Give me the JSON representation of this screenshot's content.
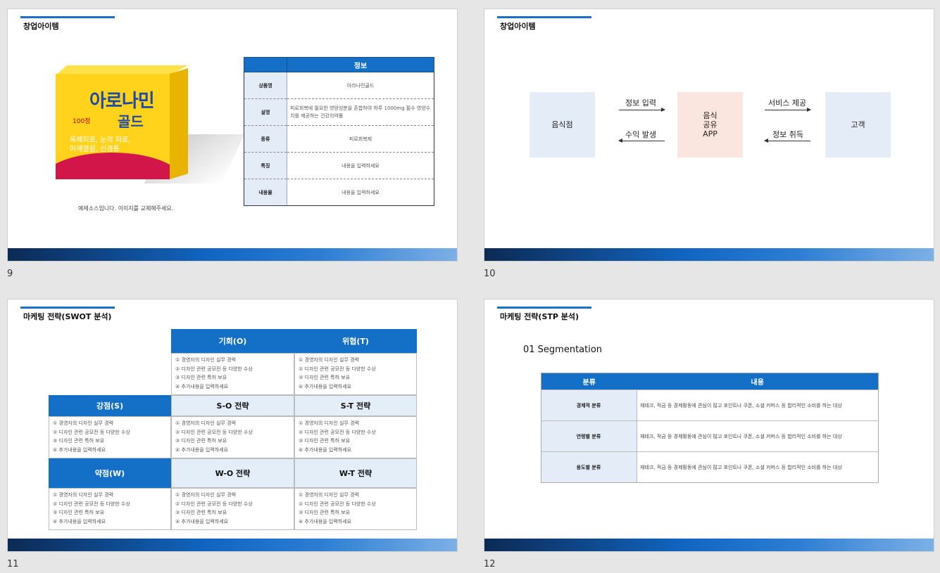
{
  "slides": {
    "s9": {
      "number": "9",
      "title": "창업아이템",
      "product": {
        "brand": "아로나민",
        "brand_sub": "골드",
        "count": "100정",
        "desc_line1": "육체피로, 눈의 피로,",
        "desc_line2": "어깨결림, 신경통"
      },
      "caption": "예제소스입니다. 이미지를 교체해주세요.",
      "table": {
        "header": "정보",
        "rows": [
          {
            "label": "상품명",
            "value": "아라나민골드"
          },
          {
            "label": "설명",
            "value": "피로회복에 필요한 영양성분을 혼합하여 하루 1000mg 필수 영양수치를 제공하는 건강의약품"
          },
          {
            "label": "종류",
            "value": "피로회복제"
          },
          {
            "label": "특징",
            "value": "내용을 입력하세요"
          },
          {
            "label": "내용물",
            "value": "내용을 입력하세요"
          }
        ]
      }
    },
    "s10": {
      "number": "10",
      "title": "창업아이템",
      "left_box": "음식점",
      "center_box": [
        "음식",
        "공유",
        "APP"
      ],
      "right_box": "고객",
      "labels": {
        "info_input": "정보 입력",
        "revenue": "수익 발생",
        "service": "서비스 제공",
        "info_get": "정보 취득"
      }
    },
    "s11": {
      "number": "11",
      "title": "마케팅 전략(SWOT 분석)",
      "opportunity": "기회(O)",
      "threat": "위협(T)",
      "strength": "강점(S)",
      "weakness": "약점(W)",
      "so": "S-O 전략",
      "st": "S-T 전략",
      "wo": "W-O 전략",
      "wt": "W-T 전략",
      "item1": "① 경영자의 디자인 실무 경력",
      "item2": "② 디자인 관련 공모전 등 다양한 수상",
      "item3": "③ 디자인 관련 특허 보유",
      "item4": "④ 추가내용을 입력하세요"
    },
    "s12": {
      "number": "12",
      "title": "마케팅 전략(STP 분석)",
      "segment_title": "01 Segmentation",
      "table": {
        "col1": "분류",
        "col2": "내용",
        "rows": [
          {
            "label": "경제적 분류",
            "value": "재테크, 적금 등 경제활동에 관심이 많고 포인트나 쿠폰, 소셜 커머스 등 합리적인 소비를 하는 대상"
          },
          {
            "label": "연령별 분류",
            "value": "재테크, 적금 등 경제활동에 관심이 많고 포인트나 쿠폰, 소셜 커머스 등 합리적인 소비를 하는 대상"
          },
          {
            "label": "용도별 분류",
            "value": "재테크, 적금 등 경제활동에 관심이 많고 포인트나 쿠폰, 소셜 커머스 등 합리적인 소비를 하는 대상"
          }
        ]
      }
    }
  },
  "colors": {
    "accent": "#1470c7",
    "light_blue": "#e3ecf7",
    "pink": "#fae6df"
  }
}
